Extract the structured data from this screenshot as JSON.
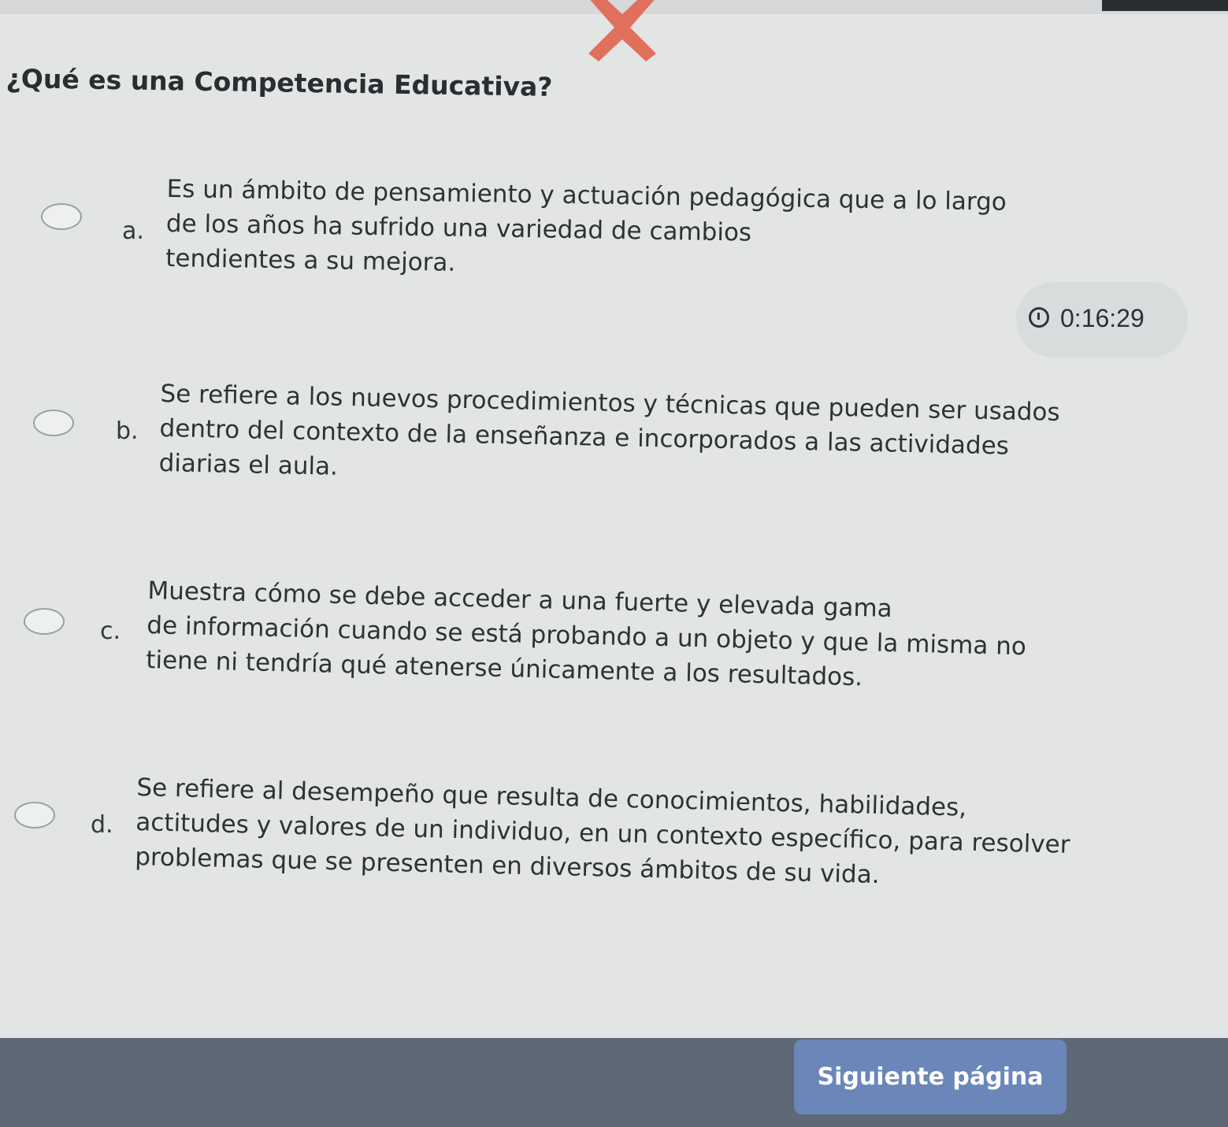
{
  "question": {
    "title": "¿Qué es una Competencia Educativa?"
  },
  "options": [
    {
      "letter": "a.",
      "lines": [
        "Es un ámbito de pensamiento y actuación pedagógica que a lo largo",
        "de los años ha sufrido una variedad de cambios",
        "tendientes a su mejora."
      ]
    },
    {
      "letter": "b.",
      "lines": [
        "Se refiere a los nuevos procedimientos y técnicas que pueden ser usados",
        "dentro del contexto de la enseñanza e incorporados a las actividades",
        "diarias el aula."
      ]
    },
    {
      "letter": "c.",
      "lines": [
        "Muestra cómo se debe acceder a una fuerte y elevada gama",
        "de información cuando se está probando a un objeto y que la misma no",
        "tiene ni tendría qué atenerse únicamente a los resultados."
      ]
    },
    {
      "letter": "d.",
      "lines": [
        "Se refiere al desempeño que resulta de conocimientos, habilidades,",
        "actitudes y valores de un individuo, en un contexto específico, para resolver",
        "problemas que se presenten en diversos ámbitos de su vida."
      ]
    }
  ],
  "timer": {
    "value": "0:16:29",
    "icon": "clock-icon"
  },
  "navigation": {
    "next_label": "Siguiente página"
  },
  "colors": {
    "accent_mark": "#e0705c",
    "button": "#6b86b9",
    "bottom_bar": "#5e6877"
  }
}
